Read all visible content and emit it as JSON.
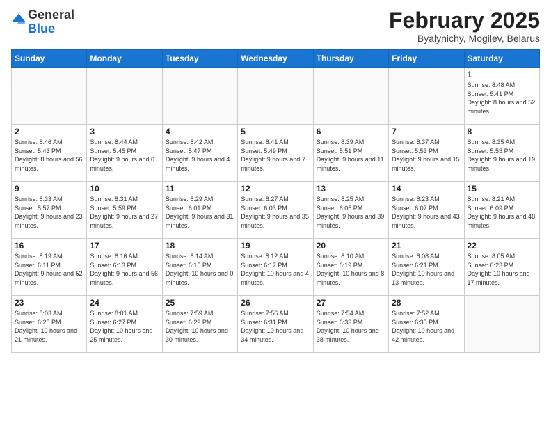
{
  "logo": {
    "line1": "General",
    "line2": "Blue"
  },
  "header": {
    "month": "February 2025",
    "location": "Byalynichy, Mogilev, Belarus"
  },
  "weekdays": [
    "Sunday",
    "Monday",
    "Tuesday",
    "Wednesday",
    "Thursday",
    "Friday",
    "Saturday"
  ],
  "weeks": [
    [
      {
        "day": "",
        "info": ""
      },
      {
        "day": "",
        "info": ""
      },
      {
        "day": "",
        "info": ""
      },
      {
        "day": "",
        "info": ""
      },
      {
        "day": "",
        "info": ""
      },
      {
        "day": "",
        "info": ""
      },
      {
        "day": "1",
        "info": "Sunrise: 8:48 AM\nSunset: 5:41 PM\nDaylight: 8 hours\nand 52 minutes."
      }
    ],
    [
      {
        "day": "2",
        "info": "Sunrise: 8:46 AM\nSunset: 5:43 PM\nDaylight: 8 hours\nand 56 minutes."
      },
      {
        "day": "3",
        "info": "Sunrise: 8:44 AM\nSunset: 5:45 PM\nDaylight: 9 hours\nand 0 minutes."
      },
      {
        "day": "4",
        "info": "Sunrise: 8:42 AM\nSunset: 5:47 PM\nDaylight: 9 hours\nand 4 minutes."
      },
      {
        "day": "5",
        "info": "Sunrise: 8:41 AM\nSunset: 5:49 PM\nDaylight: 9 hours\nand 7 minutes."
      },
      {
        "day": "6",
        "info": "Sunrise: 8:39 AM\nSunset: 5:51 PM\nDaylight: 9 hours\nand 11 minutes."
      },
      {
        "day": "7",
        "info": "Sunrise: 8:37 AM\nSunset: 5:53 PM\nDaylight: 9 hours\nand 15 minutes."
      },
      {
        "day": "8",
        "info": "Sunrise: 8:35 AM\nSunset: 5:55 PM\nDaylight: 9 hours\nand 19 minutes."
      }
    ],
    [
      {
        "day": "9",
        "info": "Sunrise: 8:33 AM\nSunset: 5:57 PM\nDaylight: 9 hours\nand 23 minutes."
      },
      {
        "day": "10",
        "info": "Sunrise: 8:31 AM\nSunset: 5:59 PM\nDaylight: 9 hours\nand 27 minutes."
      },
      {
        "day": "11",
        "info": "Sunrise: 8:29 AM\nSunset: 6:01 PM\nDaylight: 9 hours\nand 31 minutes."
      },
      {
        "day": "12",
        "info": "Sunrise: 8:27 AM\nSunset: 6:03 PM\nDaylight: 9 hours\nand 35 minutes."
      },
      {
        "day": "13",
        "info": "Sunrise: 8:25 AM\nSunset: 6:05 PM\nDaylight: 9 hours\nand 39 minutes."
      },
      {
        "day": "14",
        "info": "Sunrise: 8:23 AM\nSunset: 6:07 PM\nDaylight: 9 hours\nand 43 minutes."
      },
      {
        "day": "15",
        "info": "Sunrise: 8:21 AM\nSunset: 6:09 PM\nDaylight: 9 hours\nand 48 minutes."
      }
    ],
    [
      {
        "day": "16",
        "info": "Sunrise: 8:19 AM\nSunset: 6:11 PM\nDaylight: 9 hours\nand 52 minutes."
      },
      {
        "day": "17",
        "info": "Sunrise: 8:16 AM\nSunset: 6:13 PM\nDaylight: 9 hours\nand 56 minutes."
      },
      {
        "day": "18",
        "info": "Sunrise: 8:14 AM\nSunset: 6:15 PM\nDaylight: 10 hours\nand 0 minutes."
      },
      {
        "day": "19",
        "info": "Sunrise: 8:12 AM\nSunset: 6:17 PM\nDaylight: 10 hours\nand 4 minutes."
      },
      {
        "day": "20",
        "info": "Sunrise: 8:10 AM\nSunset: 6:19 PM\nDaylight: 10 hours\nand 8 minutes."
      },
      {
        "day": "21",
        "info": "Sunrise: 8:08 AM\nSunset: 6:21 PM\nDaylight: 10 hours\nand 13 minutes."
      },
      {
        "day": "22",
        "info": "Sunrise: 8:05 AM\nSunset: 6:23 PM\nDaylight: 10 hours\nand 17 minutes."
      }
    ],
    [
      {
        "day": "23",
        "info": "Sunrise: 8:03 AM\nSunset: 6:25 PM\nDaylight: 10 hours\nand 21 minutes."
      },
      {
        "day": "24",
        "info": "Sunrise: 8:01 AM\nSunset: 6:27 PM\nDaylight: 10 hours\nand 25 minutes."
      },
      {
        "day": "25",
        "info": "Sunrise: 7:59 AM\nSunset: 6:29 PM\nDaylight: 10 hours\nand 30 minutes."
      },
      {
        "day": "26",
        "info": "Sunrise: 7:56 AM\nSunset: 6:31 PM\nDaylight: 10 hours\nand 34 minutes."
      },
      {
        "day": "27",
        "info": "Sunrise: 7:54 AM\nSunset: 6:33 PM\nDaylight: 10 hours\nand 38 minutes."
      },
      {
        "day": "28",
        "info": "Sunrise: 7:52 AM\nSunset: 6:35 PM\nDaylight: 10 hours\nand 42 minutes."
      },
      {
        "day": "",
        "info": ""
      }
    ]
  ]
}
